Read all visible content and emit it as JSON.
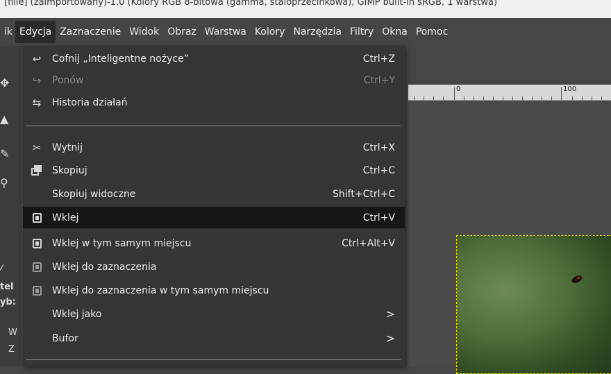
{
  "window": {
    "title_fragment": "[fille] (zaimportowany)-1.0 (Kolory RGB 8-bitowa (gamma, staloprzecinkowa), GIMP built-in sRGB, 1 warstwa)"
  },
  "menubar": {
    "items": [
      "ik",
      "Edycja",
      "Zaznaczenie",
      "Widok",
      "Obraz",
      "Warstwa",
      "Kolory",
      "Narzędzia",
      "Filtry",
      "Okna",
      "Pomoc"
    ]
  },
  "ruler": {
    "labels": [
      "0",
      "100"
    ]
  },
  "left_panel": {
    "texts": [
      "tel",
      "yb:",
      "W",
      "Z"
    ]
  },
  "edit_menu": {
    "items": [
      {
        "label": "Cofnij „Inteligentne nożyce”",
        "shortcut": "Ctrl+Z",
        "icon": "undo-icon"
      },
      {
        "label": "Ponów",
        "shortcut": "Ctrl+Y",
        "icon": "redo-icon",
        "disabled": true
      },
      {
        "label": "Historia działań",
        "shortcut": "",
        "icon": "history-icon"
      },
      {
        "label": "Wytnij",
        "shortcut": "Ctrl+X",
        "icon": "scissors-icon"
      },
      {
        "label": "Skopiuj",
        "shortcut": "Ctrl+C",
        "icon": "copy-icon"
      },
      {
        "label": "Skopiuj widoczne",
        "shortcut": "Shift+Ctrl+C",
        "icon": ""
      },
      {
        "label": "Wklej",
        "shortcut": "Ctrl+V",
        "icon": "paste-icon",
        "selected": true
      },
      {
        "label": "Wklej w tym samym miejscu",
        "shortcut": "Ctrl+Alt+V",
        "icon": "paste-icon"
      },
      {
        "label": "Wklej do zaznaczenia",
        "shortcut": "",
        "icon": "paste-into-icon"
      },
      {
        "label": "Wklej do zaznaczenia w tym samym miejscu",
        "shortcut": "",
        "icon": "paste-into-icon"
      },
      {
        "label": "Wklej jako",
        "shortcut": "",
        "icon": "",
        "submenu": ">"
      },
      {
        "label": "Bufor",
        "shortcut": "",
        "icon": "",
        "submenu": ">"
      }
    ]
  },
  "colors": {
    "menu_bg": "#353535",
    "selected_row": "#161616",
    "selection_marquee": "#ffe800"
  }
}
